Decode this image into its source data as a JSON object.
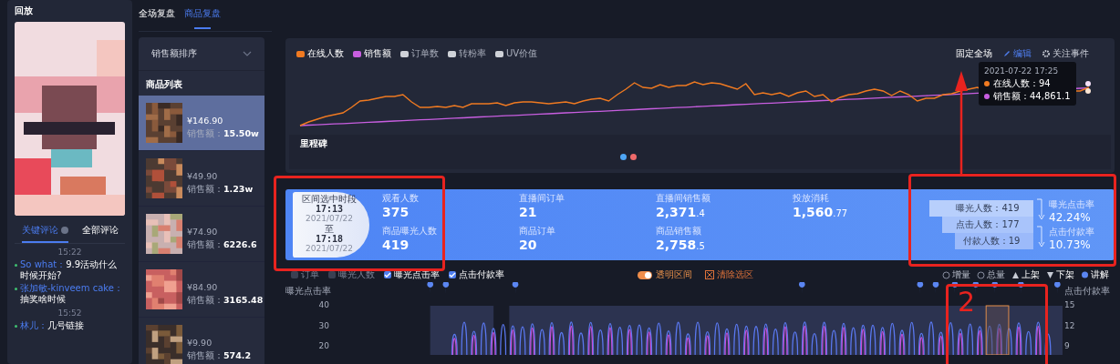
{
  "sidebar": {
    "title": "回放",
    "comment_tabs": [
      {
        "label": "关键评论",
        "selected": true,
        "info": true
      },
      {
        "label": "全部评论",
        "selected": false,
        "info": false
      }
    ],
    "comments": [
      {
        "kind": "time",
        "text": "15:22"
      },
      {
        "kind": "message",
        "user": "So what：",
        "text": "9.9活动什么时候开始?"
      },
      {
        "kind": "message",
        "user": "张加敏-kinveem cake：",
        "text": "抽奖啥时候"
      },
      {
        "kind": "time",
        "text": "15:52"
      },
      {
        "kind": "message",
        "user": "林儿：",
        "text": "几号链接"
      }
    ]
  },
  "tabs": [
    {
      "label": "全场复盘",
      "selected": false
    },
    {
      "label": "商品复盘",
      "selected": true
    }
  ],
  "products": {
    "sort": "销售额排序",
    "heading": "商品列表",
    "items": [
      {
        "price": "¥146.90",
        "sales_label": "销售额：",
        "sales": "15.50w",
        "selected": true
      },
      {
        "price": "¥49.90",
        "sales_label": "销售额：",
        "sales": "1.23w",
        "selected": false
      },
      {
        "price": "¥74.90",
        "sales_label": "销售额：",
        "sales": "6226.6",
        "selected": false
      },
      {
        "price": "¥84.90",
        "sales_label": "销售额：",
        "sales": "3165.48",
        "selected": false
      },
      {
        "price": "¥9.90",
        "sales_label": "销售额：",
        "sales": "574.2",
        "selected": false
      }
    ]
  },
  "trend": {
    "legend": [
      {
        "label": "在线人数",
        "color": "#f07a21",
        "on": true
      },
      {
        "label": "销售额",
        "color": "#c85ee0",
        "on": true
      },
      {
        "label": "订单数",
        "on": false
      },
      {
        "label": "转粉率",
        "on": false
      },
      {
        "label": "UV价值",
        "on": false
      }
    ],
    "actions": [
      {
        "kind": "plain",
        "label": "固定全场"
      },
      {
        "kind": "edit",
        "label": "编辑"
      },
      {
        "kind": "gear",
        "label": "关注事件"
      }
    ],
    "tooltip": {
      "time": "2021-07-22 17:25",
      "rows": [
        {
          "color": "#f07a21",
          "text": "在线人数：94"
        },
        {
          "color": "#c85ee0",
          "text": "销售额：44,861.1"
        }
      ]
    },
    "milestone": "里程碑"
  },
  "summary": {
    "range": {
      "title": "区间选中时段",
      "start_time": "17:13",
      "start_date": "2021/07/22",
      "to": "至",
      "end_time": "17:18",
      "end_date": "2021/07/22"
    },
    "metrics": [
      {
        "label": "观看人数",
        "value": "375"
      },
      {
        "label": "商品曝光人数",
        "value": "419"
      },
      {
        "label": "直播间订单",
        "value": "21"
      },
      {
        "label": "商品订单",
        "value": "20"
      },
      {
        "label": "直播间销售额",
        "value": "2,371.4"
      },
      {
        "label": "商品销售额",
        "value": "2,758.5"
      },
      {
        "label": "投放消耗",
        "value": "1,560.77"
      }
    ],
    "funnel": {
      "steps": [
        "曝光人数：419",
        "点击人数：177",
        "付款人数：19"
      ],
      "rates": [
        {
          "label": "曝光点击率",
          "value": "42.24%"
        },
        {
          "label": "点击付款率",
          "value": "10.73%"
        }
      ]
    }
  },
  "detail": {
    "series": [
      {
        "label": "订单",
        "checked": false
      },
      {
        "label": "曝光人数",
        "checked": false
      },
      {
        "label": "曝光点击率",
        "checked": true
      },
      {
        "label": "点击付款率",
        "checked": true
      }
    ],
    "toggle": {
      "label": "透明区间",
      "on": true
    },
    "clear": "清除选区",
    "markers": [
      {
        "kind": "ring",
        "label": "增量"
      },
      {
        "kind": "ring",
        "label": "总量"
      },
      {
        "kind": "up",
        "label": "上架"
      },
      {
        "kind": "down",
        "label": "下架"
      },
      {
        "kind": "pin",
        "label": "讲解"
      }
    ],
    "left_axis": {
      "title": "曝光点击率",
      "ticks": [
        "40",
        "30",
        "20"
      ]
    },
    "right_axis": {
      "title": "点击付款率",
      "ticks": [
        "15",
        "12",
        "9"
      ]
    }
  },
  "annotation": {
    "label": "2"
  }
}
